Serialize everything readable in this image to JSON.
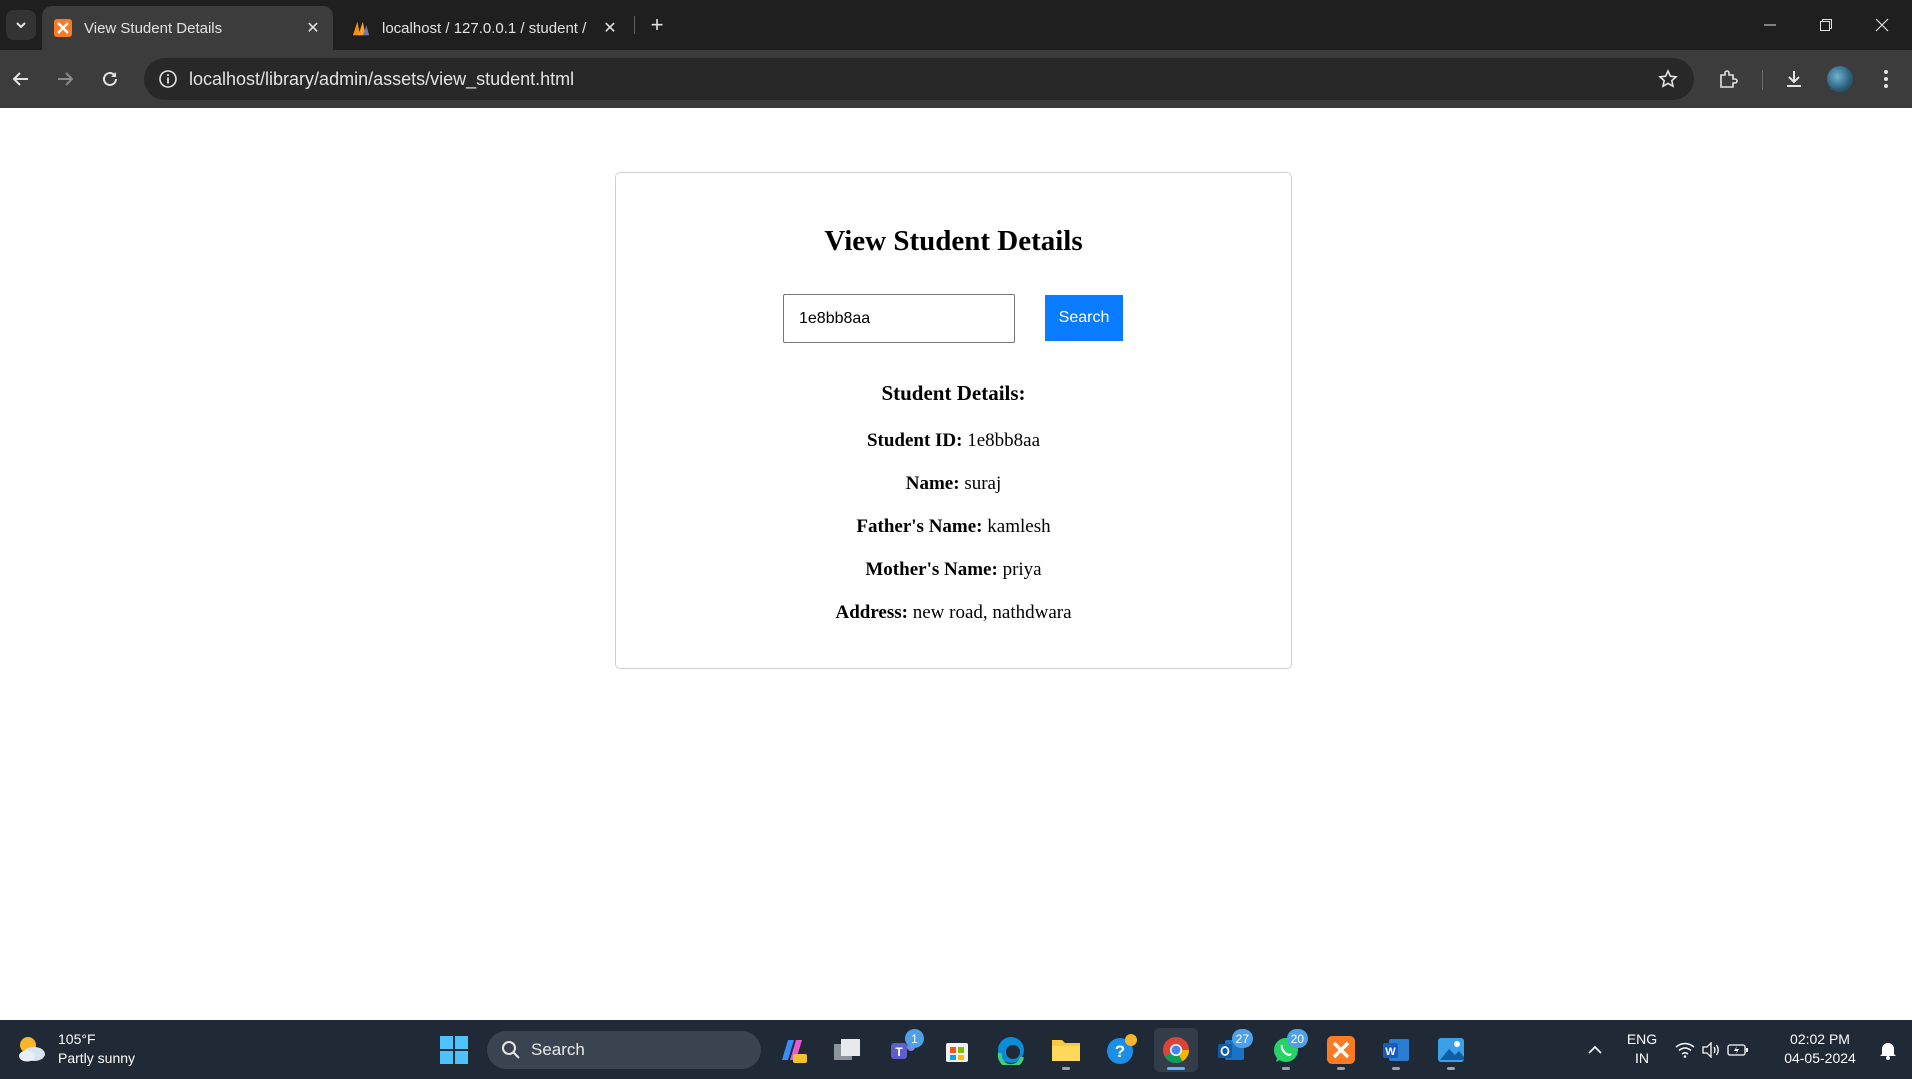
{
  "browser": {
    "tabs": [
      {
        "title": "View Student Details",
        "active": true
      },
      {
        "title": "localhost / 127.0.0.1 / student /",
        "active": false
      }
    ],
    "url": "localhost/library/admin/assets/view_student.html"
  },
  "page": {
    "heading": "View Student Details",
    "search": {
      "value": "1e8bb8aa",
      "button_label": "Search"
    },
    "details_heading": "Student Details:",
    "details": [
      {
        "label": "Student ID:",
        "value": "1e8bb8aa"
      },
      {
        "label": "Name:",
        "value": "suraj"
      },
      {
        "label": "Father's Name:",
        "value": "kamlesh"
      },
      {
        "label": "Mother's Name:",
        "value": "priya"
      },
      {
        "label": "Address:",
        "value": "new road, nathdwara"
      }
    ],
    "colors": {
      "search_button": "#0a7cff"
    }
  },
  "taskbar": {
    "weather": {
      "temp": "105°F",
      "condition": "Partly sunny"
    },
    "search_label": "Search",
    "badges": {
      "teams": "1",
      "outlook": "27",
      "whatsapp": "20"
    },
    "language": {
      "line1": "ENG",
      "line2": "IN"
    },
    "clock": {
      "time": "02:02 PM",
      "date": "04-05-2024"
    }
  }
}
